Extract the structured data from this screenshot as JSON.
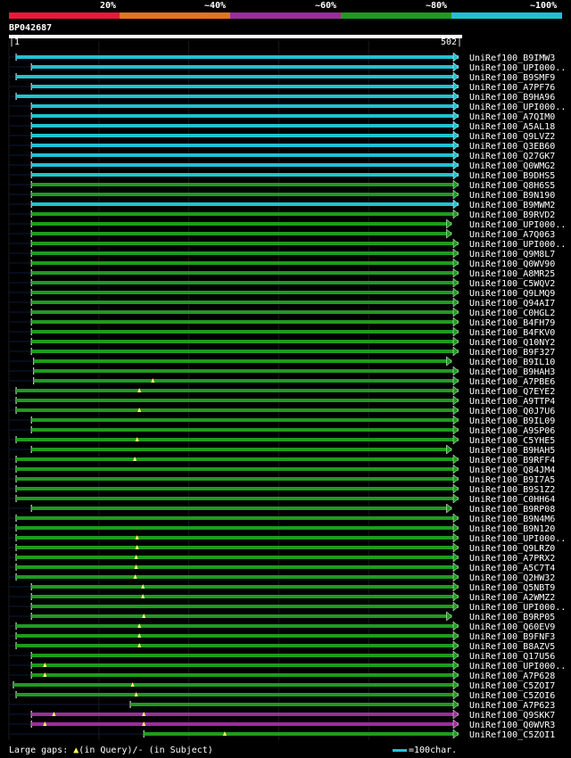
{
  "legend": {
    "labels": [
      "20%",
      "~40%",
      "~60%",
      "~80%",
      "~100%"
    ],
    "colors": [
      "#e8193c",
      "#e37421",
      "#9c2d9c",
      "#1f9b1f",
      "#22c1d1"
    ]
  },
  "query": {
    "id": "BP042687",
    "length": 502,
    "start_label": "|1",
    "end_label": "502|"
  },
  "hits": [
    {
      "name": "UniRef100_B9IMW3",
      "color": "cyan",
      "start": 0.016,
      "end": 1.0
    },
    {
      "name": "UniRef100_UPI000..",
      "color": "cyan",
      "start": 0.05,
      "end": 1.0
    },
    {
      "name": "UniRef100_B9SMF9",
      "color": "cyan",
      "start": 0.016,
      "end": 1.0
    },
    {
      "name": "UniRef100_A7PF76",
      "color": "cyan",
      "start": 0.05,
      "end": 1.0
    },
    {
      "name": "UniRef100_B9HA96",
      "color": "cyan",
      "start": 0.016,
      "end": 1.0
    },
    {
      "name": "UniRef100_UPI000..",
      "color": "cyan",
      "start": 0.05,
      "end": 1.0
    },
    {
      "name": "UniRef100_A7QIM0",
      "color": "cyan",
      "start": 0.05,
      "end": 1.0
    },
    {
      "name": "UniRef100_A5AL18",
      "color": "cyan",
      "start": 0.05,
      "end": 1.0
    },
    {
      "name": "UniRef100_Q9LVZ2",
      "color": "cyan",
      "start": 0.05,
      "end": 1.0
    },
    {
      "name": "UniRef100_Q3EB60",
      "color": "cyan",
      "start": 0.05,
      "end": 1.0
    },
    {
      "name": "UniRef100_Q27GK7",
      "color": "cyan",
      "start": 0.05,
      "end": 1.0
    },
    {
      "name": "UniRef100_Q0WMG2",
      "color": "cyan",
      "start": 0.05,
      "end": 1.0
    },
    {
      "name": "UniRef100_B9DHS5",
      "color": "cyan",
      "start": 0.05,
      "end": 1.0
    },
    {
      "name": "UniRef100_Q8H6S5",
      "color": "green",
      "start": 0.05,
      "end": 1.0
    },
    {
      "name": "UniRef100_B9N190",
      "color": "green",
      "start": 0.05,
      "end": 1.0
    },
    {
      "name": "UniRef100_B9MWM2",
      "color": "cyan",
      "start": 0.05,
      "end": 1.0
    },
    {
      "name": "UniRef100_B9RVD2",
      "color": "green",
      "start": 0.05,
      "end": 1.0
    },
    {
      "name": "UniRef100_UPI000..",
      "color": "green",
      "start": 0.05,
      "end": 0.985
    },
    {
      "name": "UniRef100_A7Q063",
      "color": "green",
      "start": 0.05,
      "end": 0.985
    },
    {
      "name": "UniRef100_UPI000..",
      "color": "green",
      "start": 0.05,
      "end": 1.0
    },
    {
      "name": "UniRef100_Q9M8L7",
      "color": "green",
      "start": 0.05,
      "end": 1.0
    },
    {
      "name": "UniRef100_Q0WV90",
      "color": "green",
      "start": 0.05,
      "end": 1.0
    },
    {
      "name": "UniRef100_A8MR25",
      "color": "green",
      "start": 0.05,
      "end": 1.0
    },
    {
      "name": "UniRef100_C5WQV2",
      "color": "green",
      "start": 0.05,
      "end": 1.0
    },
    {
      "name": "UniRef100_Q9LMQ9",
      "color": "green",
      "start": 0.05,
      "end": 1.0
    },
    {
      "name": "UniRef100_Q94AI7",
      "color": "green",
      "start": 0.05,
      "end": 1.0
    },
    {
      "name": "UniRef100_C0HGL2",
      "color": "green",
      "start": 0.05,
      "end": 1.0
    },
    {
      "name": "UniRef100_B4FH79",
      "color": "green",
      "start": 0.05,
      "end": 1.0
    },
    {
      "name": "UniRef100_B4FKV0",
      "color": "green",
      "start": 0.05,
      "end": 1.0
    },
    {
      "name": "UniRef100_Q10NY2",
      "color": "green",
      "start": 0.05,
      "end": 1.0
    },
    {
      "name": "UniRef100_B9F327",
      "color": "green",
      "start": 0.05,
      "end": 1.0
    },
    {
      "name": "UniRef100_B9IL10",
      "color": "green",
      "start": 0.055,
      "end": 0.985
    },
    {
      "name": "UniRef100_B9HAH3",
      "color": "green",
      "start": 0.055,
      "end": 1.0
    },
    {
      "name": "UniRef100_A7PBE6",
      "color": "green",
      "start": 0.055,
      "end": 1.0,
      "marker": 0.32
    },
    {
      "name": "UniRef100_Q7EYE2",
      "color": "green",
      "start": 0.016,
      "end": 1.0,
      "marker": 0.29
    },
    {
      "name": "UniRef100_A9TTP4",
      "color": "green",
      "start": 0.016,
      "end": 1.0
    },
    {
      "name": "UniRef100_Q0J7U6",
      "color": "green",
      "start": 0.016,
      "end": 1.0,
      "marker": 0.29
    },
    {
      "name": "UniRef100_B9IL09",
      "color": "green",
      "start": 0.05,
      "end": 1.0
    },
    {
      "name": "UniRef100_A9SP06",
      "color": "green",
      "start": 0.05,
      "end": 1.0
    },
    {
      "name": "UniRef100_C5YHE5",
      "color": "green",
      "start": 0.016,
      "end": 1.0,
      "marker": 0.285
    },
    {
      "name": "UniRef100_B9HAH5",
      "color": "green",
      "start": 0.05,
      "end": 0.985
    },
    {
      "name": "UniRef100_B9RFF4",
      "color": "green",
      "start": 0.016,
      "end": 1.0,
      "marker": 0.28
    },
    {
      "name": "UniRef100_Q84JM4",
      "color": "green",
      "start": 0.016,
      "end": 1.0
    },
    {
      "name": "UniRef100_B9I7A5",
      "color": "green",
      "start": 0.016,
      "end": 1.0
    },
    {
      "name": "UniRef100_B9S1Z2",
      "color": "green",
      "start": 0.016,
      "end": 1.0
    },
    {
      "name": "UniRef100_C0HH64",
      "color": "green",
      "start": 0.016,
      "end": 1.0
    },
    {
      "name": "UniRef100_B9RP08",
      "color": "green",
      "start": 0.05,
      "end": 0.985
    },
    {
      "name": "UniRef100_B9N4M6",
      "color": "green",
      "start": 0.016,
      "end": 1.0
    },
    {
      "name": "UniRef100_B9N120",
      "color": "green",
      "start": 0.016,
      "end": 1.0
    },
    {
      "name": "UniRef100_UPI000..",
      "color": "green",
      "start": 0.016,
      "end": 1.0,
      "marker": 0.285
    },
    {
      "name": "UniRef100_Q9LRZ0",
      "color": "green",
      "start": 0.016,
      "end": 1.0,
      "marker": 0.285
    },
    {
      "name": "UniRef100_A7PRX2",
      "color": "green",
      "start": 0.016,
      "end": 1.0,
      "marker": 0.283
    },
    {
      "name": "UniRef100_A5C7T4",
      "color": "green",
      "start": 0.016,
      "end": 1.0,
      "marker": 0.283
    },
    {
      "name": "UniRef100_Q2HW32",
      "color": "green",
      "start": 0.016,
      "end": 1.0,
      "marker": 0.281
    },
    {
      "name": "UniRef100_Q5NBT9",
      "color": "green",
      "start": 0.05,
      "end": 1.0,
      "marker": 0.298
    },
    {
      "name": "UniRef100_A2WMZ2",
      "color": "green",
      "start": 0.05,
      "end": 1.0,
      "marker": 0.298
    },
    {
      "name": "UniRef100_UPI000..",
      "color": "green",
      "start": 0.05,
      "end": 1.0
    },
    {
      "name": "UniRef100_B9RP05",
      "color": "green",
      "start": 0.05,
      "end": 0.985,
      "marker": 0.3
    },
    {
      "name": "UniRef100_Q60EV9",
      "color": "green",
      "start": 0.016,
      "end": 1.0,
      "marker": 0.29
    },
    {
      "name": "UniRef100_B9FNF3",
      "color": "green",
      "start": 0.016,
      "end": 1.0,
      "marker": 0.29
    },
    {
      "name": "UniRef100_B8AZV5",
      "color": "green",
      "start": 0.016,
      "end": 1.0,
      "marker": 0.29
    },
    {
      "name": "UniRef100_Q17U56",
      "color": "green",
      "start": 0.05,
      "end": 1.0
    },
    {
      "name": "UniRef100_UPI000..",
      "color": "green",
      "start": 0.05,
      "end": 1.0,
      "marker": 0.08
    },
    {
      "name": "UniRef100_A7P628",
      "color": "green",
      "start": 0.05,
      "end": 1.0,
      "marker": 0.08
    },
    {
      "name": "UniRef100_C5ZOI7",
      "color": "green",
      "start": 0.01,
      "end": 1.0,
      "marker": 0.275
    },
    {
      "name": "UniRef100_C5ZOI6",
      "color": "green",
      "start": 0.016,
      "end": 1.0,
      "marker": 0.283
    },
    {
      "name": "UniRef100_A7P623",
      "color": "green",
      "start": 0.27,
      "end": 1.0
    },
    {
      "name": "UniRef100_Q9SKK7",
      "color": "purple",
      "start": 0.05,
      "end": 1.0,
      "marker": 0.1,
      "marker2": 0.3
    },
    {
      "name": "UniRef100_Q0WVR3",
      "color": "purple",
      "start": 0.05,
      "end": 1.0,
      "marker": 0.08,
      "marker2": 0.3
    },
    {
      "name": "UniRef100_C5ZOI1",
      "color": "green",
      "start": 0.3,
      "end": 1.0,
      "marker": 0.48
    }
  ],
  "footer": {
    "large_gaps": "Large gaps:",
    "in_query": "(in Query)/",
    "in_subject": "- (in Subject)",
    "scale": "=100char."
  }
}
